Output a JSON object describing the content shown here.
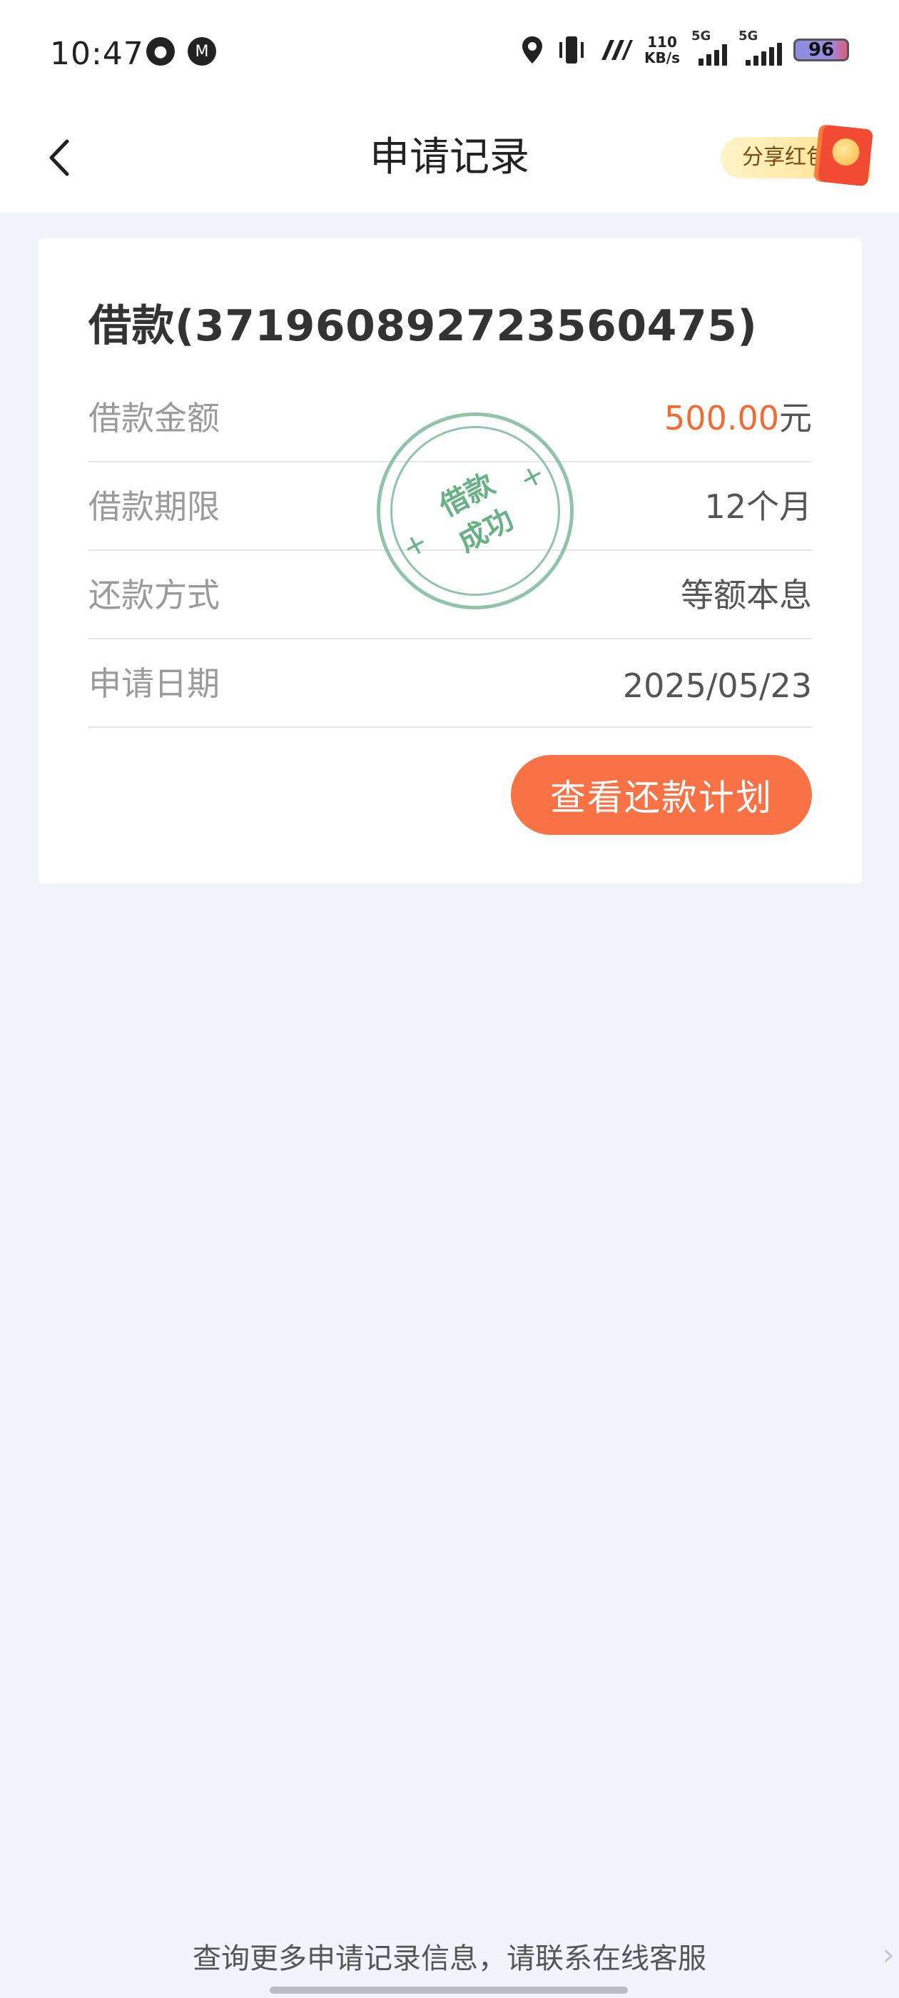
{
  "status_bar": {
    "time": "10:47",
    "net_speed_value": "110",
    "net_speed_unit": "KB/s",
    "signal1_label": "5G",
    "signal2_label": "5G",
    "battery": "96"
  },
  "nav": {
    "title": "申请记录",
    "share_label": "分享红包"
  },
  "loan": {
    "title": "借款(371960892723560475)",
    "rows": [
      {
        "label": "借款金额",
        "amount": "500.00",
        "unit": "元"
      },
      {
        "label": "借款期限",
        "value": "12个月"
      },
      {
        "label": "还款方式",
        "value": "等额本息"
      },
      {
        "label": "申请日期",
        "value": "2025/05/23"
      }
    ],
    "stamp_line1": "借款",
    "stamp_line2": "成功",
    "button_label": "查看还款计划"
  },
  "footer": {
    "note": "查询更多申请记录信息，请联系在线客服"
  },
  "colors": {
    "accent": "#f97245",
    "amount": "#f26b33",
    "stamp": "#5fae7f"
  }
}
